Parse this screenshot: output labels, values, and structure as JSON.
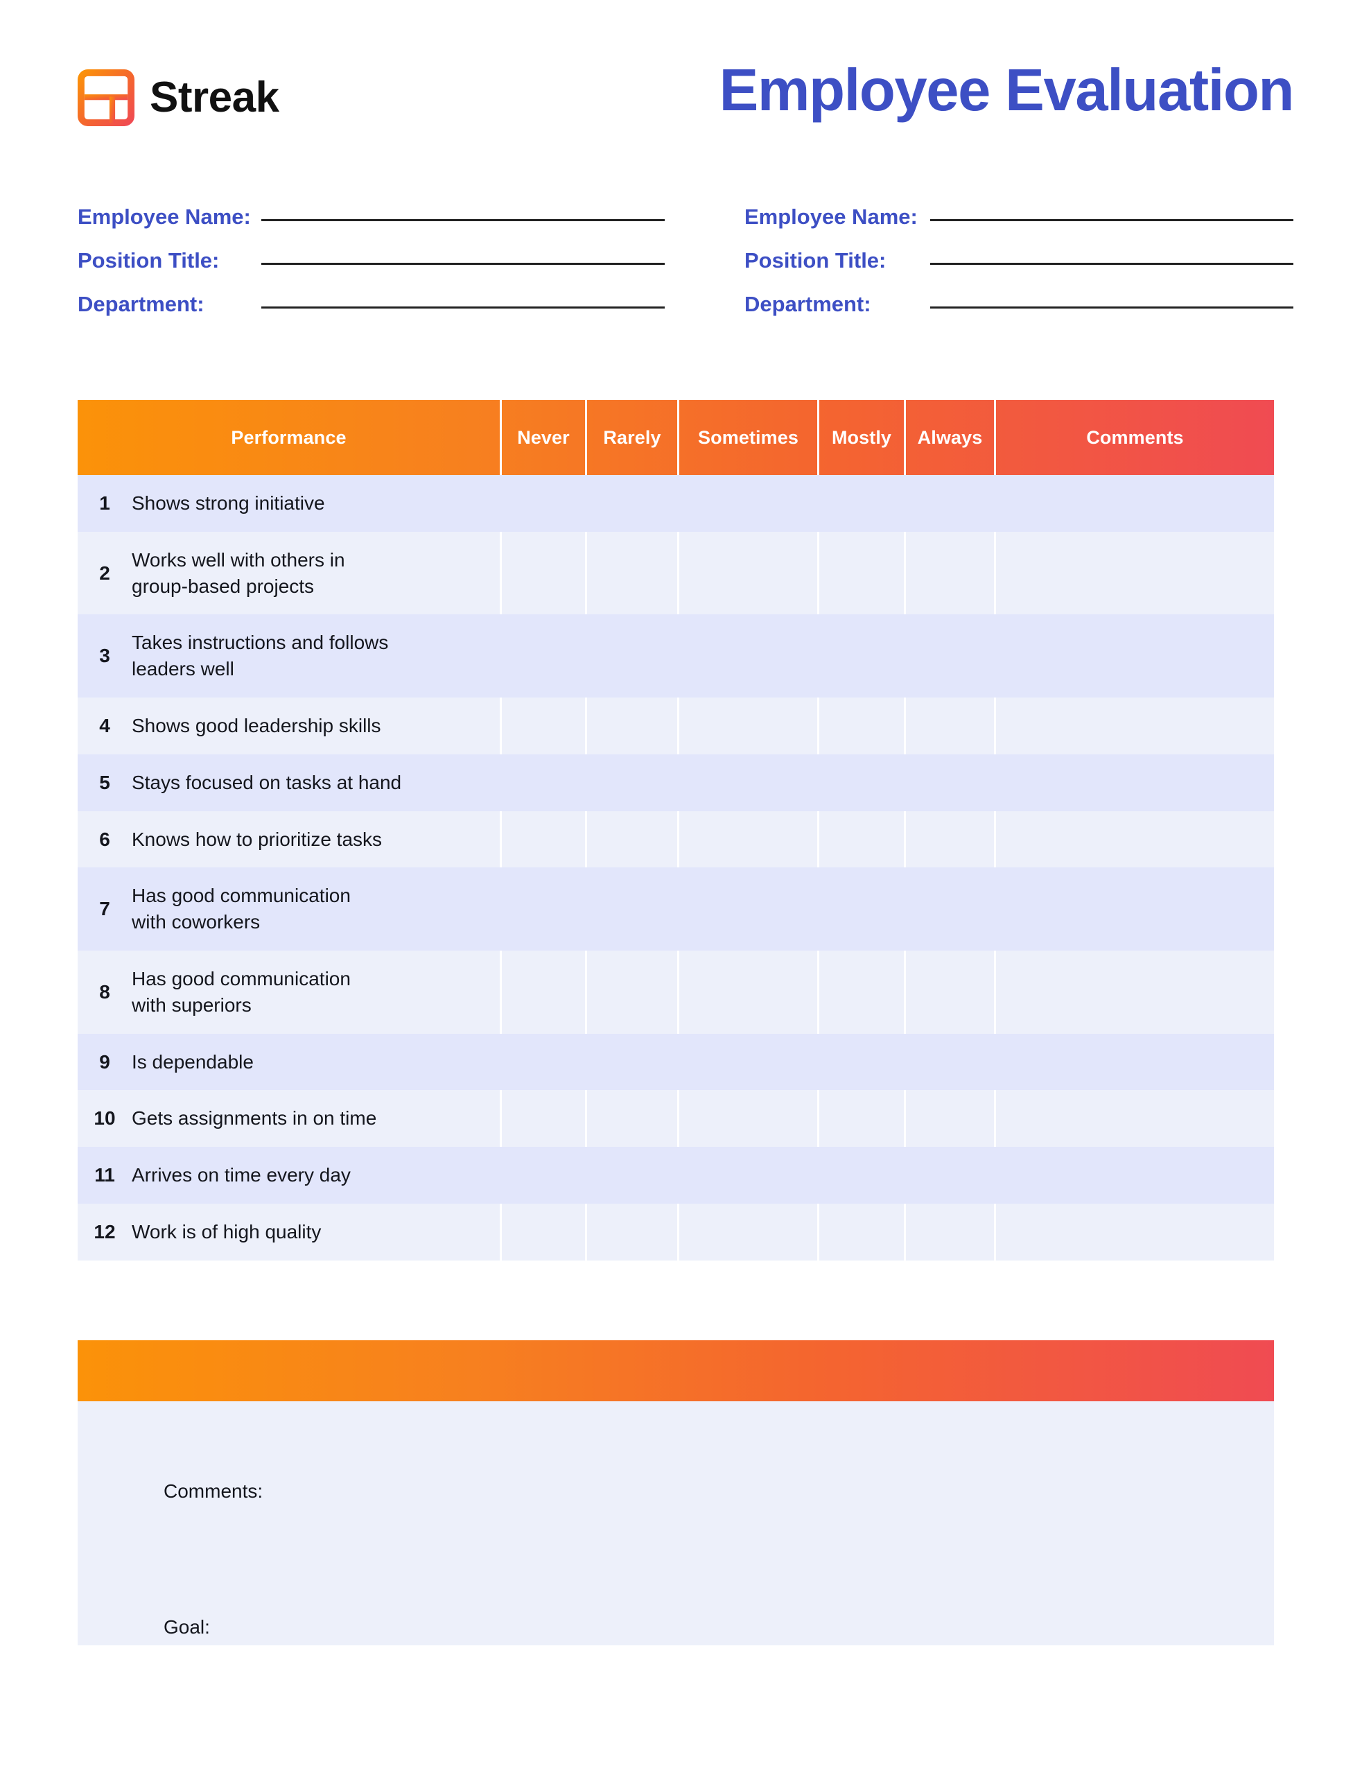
{
  "brand": {
    "name": "Streak",
    "logo_icon": "streak-grid-logo-icon"
  },
  "document": {
    "title": "Employee Evaluation"
  },
  "colors": {
    "title_blue": "#3D4FC4",
    "label_blue": "#3D4FC4",
    "gradient_start": "#FB9209",
    "gradient_end": "#F04B52",
    "row_shade_dark": "#E2E6FB",
    "row_shade_light": "#EDF0FA",
    "text_black": "#14161D"
  },
  "identity": {
    "left": {
      "employee_name_label": "Employee Name:",
      "employee_name_value": "",
      "position_title_label": "Position Title:",
      "position_title_value": "",
      "department_label": "Department:",
      "department_value": ""
    },
    "right": {
      "employee_name_label": "Employee Name:",
      "employee_name_value": "",
      "position_title_label": "Position Title:",
      "position_title_value": "",
      "department_label": "Department:",
      "department_value": ""
    }
  },
  "table": {
    "headers": {
      "performance": "Performance",
      "never": "Never",
      "rarely": "Rarely",
      "sometimes": "Sometimes",
      "mostly": "Mostly",
      "always": "Always",
      "comments": "Comments"
    },
    "rows": [
      {
        "num": "1",
        "text": "Shows strong initiative",
        "never": "",
        "rarely": "",
        "sometimes": "",
        "mostly": "",
        "always": "",
        "comments": ""
      },
      {
        "num": "2",
        "text": "Works well with others in\ngroup-based projects",
        "never": "",
        "rarely": "",
        "sometimes": "",
        "mostly": "",
        "always": "",
        "comments": ""
      },
      {
        "num": "3",
        "text": "Takes instructions and follows\nleaders well",
        "never": "",
        "rarely": "",
        "sometimes": "",
        "mostly": "",
        "always": "",
        "comments": ""
      },
      {
        "num": "4",
        "text": "Shows good leadership skills",
        "never": "",
        "rarely": "",
        "sometimes": "",
        "mostly": "",
        "always": "",
        "comments": ""
      },
      {
        "num": "5",
        "text": "Stays focused on tasks at hand",
        "never": "",
        "rarely": "",
        "sometimes": "",
        "mostly": "",
        "always": "",
        "comments": ""
      },
      {
        "num": "6",
        "text": "Knows how to prioritize tasks",
        "never": "",
        "rarely": "",
        "sometimes": "",
        "mostly": "",
        "always": "",
        "comments": ""
      },
      {
        "num": "7",
        "text": "Has good communication\nwith coworkers",
        "never": "",
        "rarely": "",
        "sometimes": "",
        "mostly": "",
        "always": "",
        "comments": ""
      },
      {
        "num": "8",
        "text": "Has good communication\nwith superiors",
        "never": "",
        "rarely": "",
        "sometimes": "",
        "mostly": "",
        "always": "",
        "comments": ""
      },
      {
        "num": "9",
        "text": "Is dependable",
        "never": "",
        "rarely": "",
        "sometimes": "",
        "mostly": "",
        "always": "",
        "comments": ""
      },
      {
        "num": "10",
        "text": "Gets assignments in on time",
        "never": "",
        "rarely": "",
        "sometimes": "",
        "mostly": "",
        "always": "",
        "comments": ""
      },
      {
        "num": "11",
        "text": "Arrives on time every day",
        "never": "",
        "rarely": "",
        "sometimes": "",
        "mostly": "",
        "always": "",
        "comments": ""
      },
      {
        "num": "12",
        "text": "Work is of high quality",
        "never": "",
        "rarely": "",
        "sometimes": "",
        "mostly": "",
        "always": "",
        "comments": ""
      }
    ]
  },
  "notes": {
    "bar_label": "",
    "comments_label": "Comments:",
    "comments_value": "",
    "goal_label": "Goal:",
    "goal_value": ""
  }
}
